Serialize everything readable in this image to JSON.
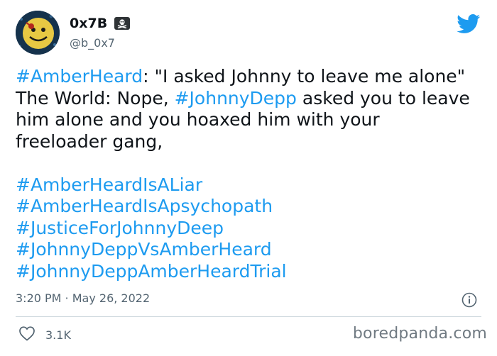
{
  "author": {
    "display_name": "0x7B",
    "handle": "@b_0x7",
    "badge_icon": "skull-crossbones-icon"
  },
  "tweet": {
    "line1_tag": "#AmberHeard",
    "line1_rest": ": \"I asked Johnny to leave me alone\"",
    "line2_pre": "The World: Nope, ",
    "line2_tag": "#JohnnyDepp",
    "line2_post": " asked you to leave",
    "line3": "him alone and you hoaxed him with your",
    "line4": "freeloader gang,",
    "hashtags": [
      "#AmberHeardIsALiar",
      "#AmberHeardIsApsychopath",
      "#JusticeForJohnnyDeep",
      "#JohnnyDeppVsAmberHeard",
      "#JohnnyDeppAmberHeardTrial"
    ],
    "timestamp": "3:20 PM · May 26, 2022",
    "like_count": "3.1K"
  },
  "watermark": "boredpanda.com",
  "colors": {
    "hashtag": "#1d9bf0",
    "twitter_blue": "#1d9bf0",
    "secondary_text": "#536471"
  }
}
